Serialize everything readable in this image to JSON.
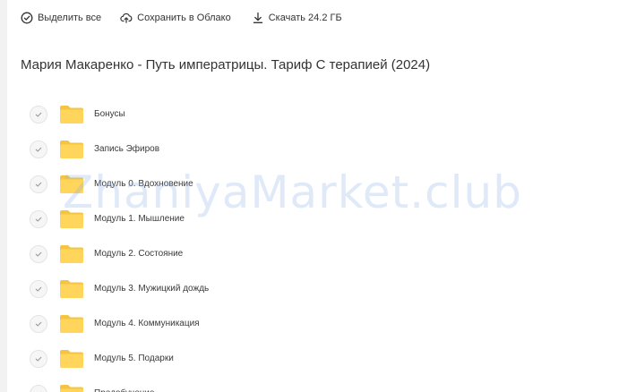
{
  "toolbar": {
    "select_all_label": "Выделить все",
    "select_all_icon": "check-circle-icon",
    "save_cloud_label": "Сохранить в Облако",
    "save_cloud_icon": "cloud-upload-icon",
    "download_label": "Скачать 24.2 ГБ",
    "download_icon": "download-icon"
  },
  "folder": {
    "title": "Мария Макаренко - Путь императрицы. Тариф С терапией (2024)"
  },
  "items": [
    {
      "label": "Бонусы",
      "icon": "folder-icon"
    },
    {
      "label": "Запись Эфиров",
      "icon": "folder-icon"
    },
    {
      "label": "Модуль 0. Вдохновение",
      "icon": "folder-icon"
    },
    {
      "label": "Модуль 1. Мышление",
      "icon": "folder-icon"
    },
    {
      "label": "Модуль 2. Состояние",
      "icon": "folder-icon"
    },
    {
      "label": "Модуль 3. Мужицкий дождь",
      "icon": "folder-icon"
    },
    {
      "label": "Модуль 4. Коммуникация",
      "icon": "folder-icon"
    },
    {
      "label": "Модуль 5. Подарки",
      "icon": "folder-icon"
    },
    {
      "label": "Предобучение",
      "icon": "folder-icon"
    }
  ],
  "watermark": "ZhaniyaMarket.club",
  "colors": {
    "folder": "#FFD55B",
    "folder_tab": "#F5C542",
    "check": "#9a9a9a",
    "background": "#f2f2f2",
    "panel": "#ffffff"
  }
}
